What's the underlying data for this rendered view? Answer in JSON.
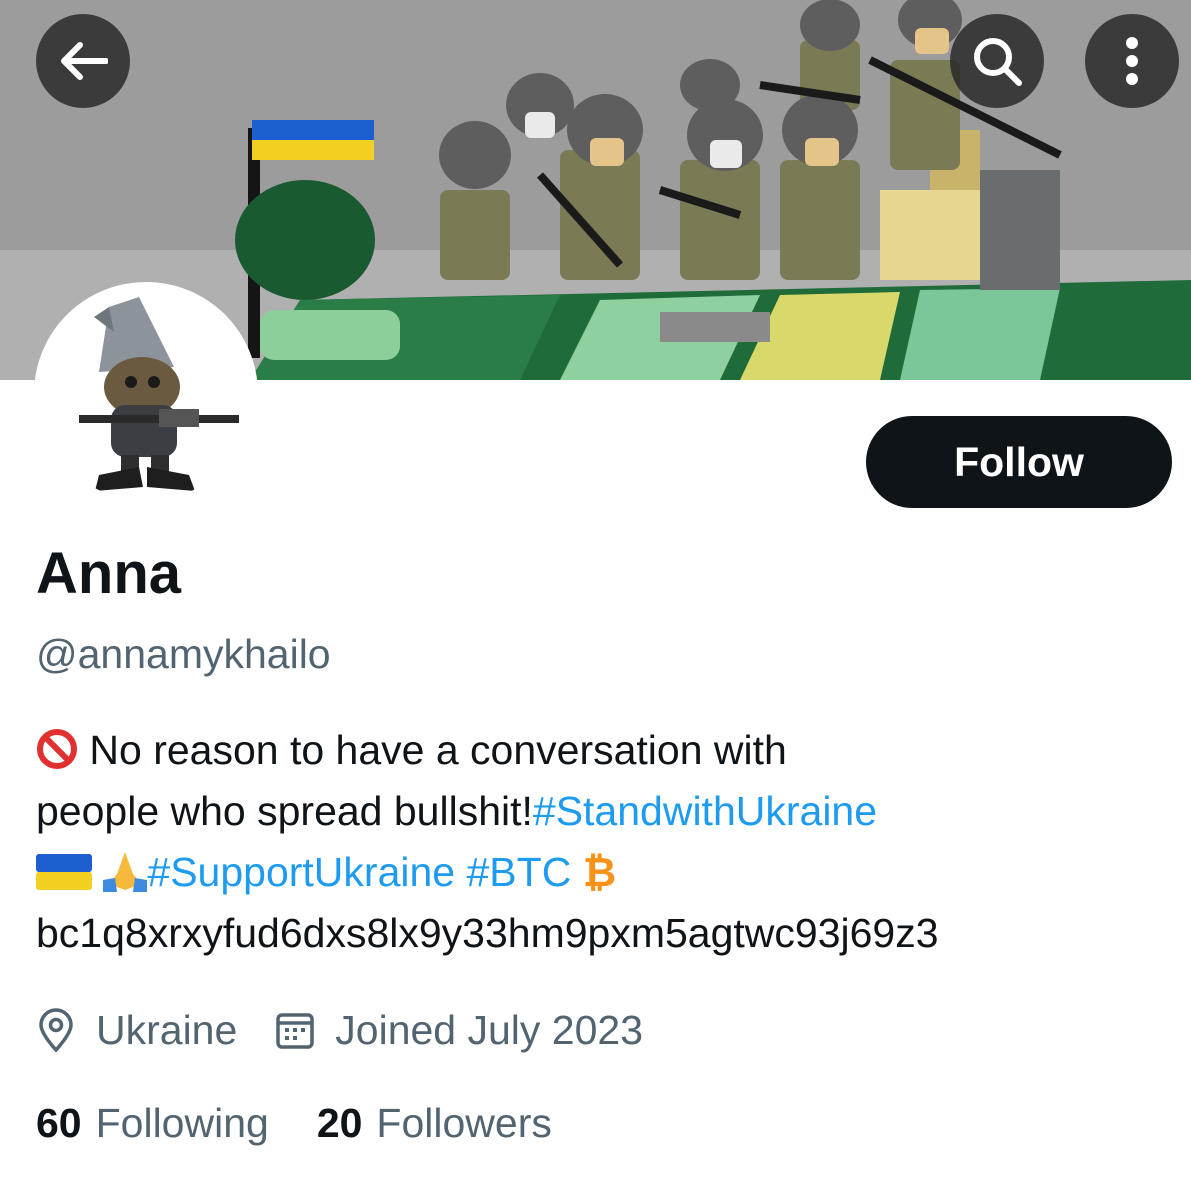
{
  "header": {
    "banner_icon": "ukraine-lego-soldiers-banner",
    "back_icon": "arrow-left-icon",
    "search_icon": "search-icon",
    "more_icon": "more-vertical-icon"
  },
  "profile": {
    "avatar_icon": "gnome-soldier-avatar",
    "follow_label": "Follow",
    "name": "Anna",
    "handle": "@annamykhailo",
    "bio": {
      "line1_text": "No reason to have a conversation with",
      "line2_text": "people who spread bullshit!",
      "tag_stand": "#StandwithUkraine",
      "tag_support": "#SupportUkraine",
      "tag_btc": "#BTC",
      "btc_symbol": "₿",
      "wallet": "bc1q8xrxyfud6dxs8lx9y33hm9pxm5agtwc93j69z3"
    },
    "location": "Ukraine",
    "joined": "Joined July 2023",
    "following_count": "60",
    "following_label": "Following",
    "followers_count": "20",
    "followers_label": "Followers"
  },
  "colors": {
    "link": "#1d9bf0",
    "secondary_text": "#536471",
    "primary_text": "#0f1419",
    "button_bg": "#0f1419",
    "btc": "#f7931a"
  }
}
